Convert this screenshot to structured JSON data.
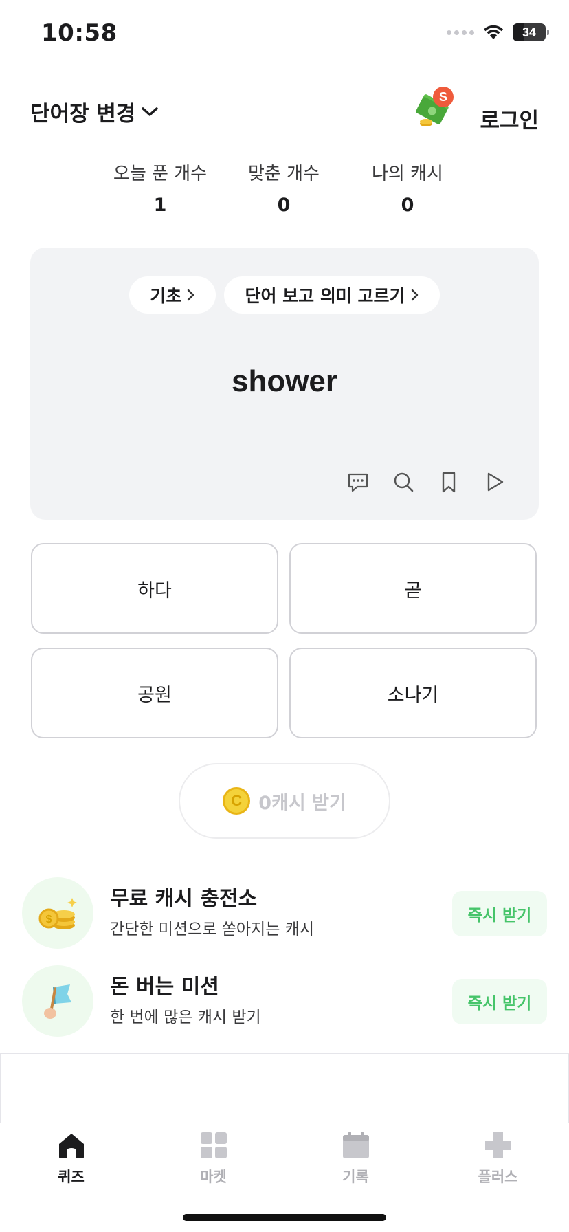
{
  "status_bar": {
    "time": "10:58",
    "battery_level": "34"
  },
  "header": {
    "wordbook_label": "단어장 변경",
    "money_badge": "S",
    "login_label": "로그인"
  },
  "stats": [
    {
      "label": "오늘 푼 개수",
      "value": "1"
    },
    {
      "label": "맞춘 개수",
      "value": "0"
    },
    {
      "label": "나의 캐시",
      "value": "0"
    }
  ],
  "quiz": {
    "level_chip": "기초",
    "mode_chip": "단어 보고 의미 고르기",
    "word": "shower",
    "tools": [
      "comment-icon",
      "search-icon",
      "bookmark-icon",
      "play-icon"
    ]
  },
  "options": [
    "하다",
    "곧",
    "공원",
    "소나기"
  ],
  "claim": {
    "coin_symbol": "C",
    "label": "0캐시 받기"
  },
  "missions": [
    {
      "title": "무료 캐시 충전소",
      "subtitle": "간단한 미션으로 쏟아지는 캐시",
      "button": "즉시 받기",
      "icon": "coins-icon"
    },
    {
      "title": "돈 버는 미션",
      "subtitle": "한 번에 많은 캐시 받기",
      "button": "즉시 받기",
      "icon": "flag-icon"
    }
  ],
  "tabs": [
    {
      "label": "퀴즈",
      "icon": "home-icon",
      "active": true
    },
    {
      "label": "마켓",
      "icon": "grid-icon",
      "active": false
    },
    {
      "label": "기록",
      "icon": "calendar-icon",
      "active": false
    },
    {
      "label": "플러스",
      "icon": "plus-icon",
      "active": false
    }
  ],
  "colors": {
    "accent_green": "#46c46a",
    "badge_red": "#ef5b3c",
    "card_bg": "#f2f3f5"
  }
}
